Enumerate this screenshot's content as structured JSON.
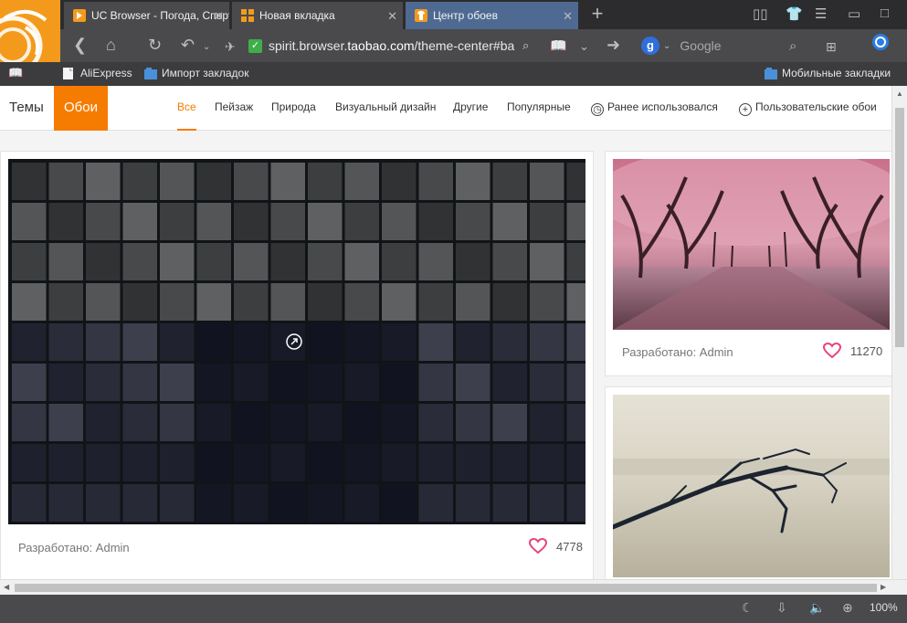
{
  "tabs": [
    {
      "title": "UC Browser - Погода, Спорт, Новости"
    },
    {
      "title": "Новая вкладка"
    },
    {
      "title": "Центр обоев"
    }
  ],
  "address": {
    "url_prefix": "spirit.browser.",
    "url_domain": "taobao.com",
    "url_suffix": "/theme-center#ba"
  },
  "search": {
    "placeholder": "Google"
  },
  "bookmarks": {
    "items": [
      {
        "label": "AliExpress"
      },
      {
        "label": "Импорт закладок"
      }
    ],
    "mobile": "Мобильные закладки"
  },
  "nav": {
    "themes": "Темы",
    "wallpapers": "Обои",
    "categories": [
      {
        "label": "Все"
      },
      {
        "label": "Пейзаж"
      },
      {
        "label": "Природа"
      },
      {
        "label": "Визуальный дизайн"
      },
      {
        "label": "Другие"
      },
      {
        "label": "Популярные"
      }
    ],
    "recent": "Ранее использовался",
    "custom": "Пользовательские обои"
  },
  "cards": [
    {
      "author": "Разработано: Admin",
      "likes": "4778"
    },
    {
      "author": "Разработано: Admin",
      "likes": "11270"
    }
  ],
  "status": {
    "zoom": "100%"
  },
  "colors": {
    "accent": "#f57c00",
    "heart": "#e8437c",
    "tab_active": "#4f6a92"
  }
}
